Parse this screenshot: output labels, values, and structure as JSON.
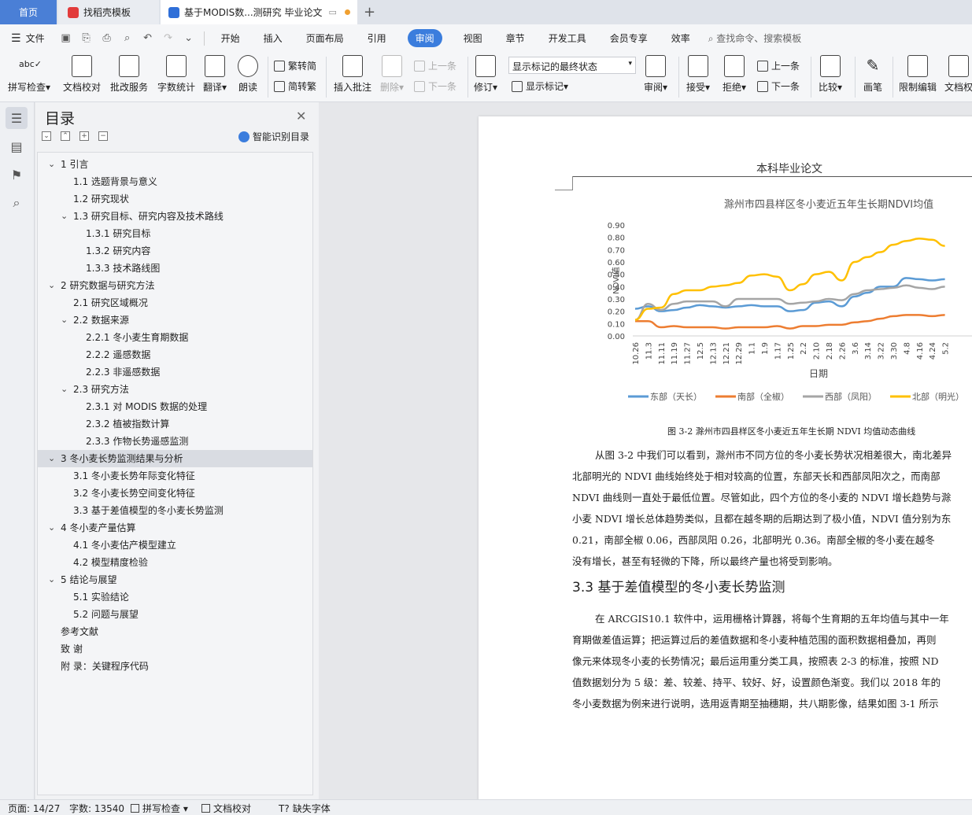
{
  "tabs": {
    "home": "首页",
    "template": "找稻壳模板",
    "doc": "基于MODIS数...测研究 毕业论文"
  },
  "menu": {
    "file": "文件",
    "items": [
      "开始",
      "插入",
      "页面布局",
      "引用",
      "审阅",
      "视图",
      "章节",
      "开发工具",
      "会员专享",
      "效率"
    ],
    "active": "审阅",
    "search": "查找命令、搜索模板"
  },
  "ribbon": {
    "spell": "拼写检查",
    "doc_check": "文档校对",
    "batch": "批改服务",
    "word_count": "字数统计",
    "translate": "翻译",
    "read": "朗读",
    "to_trad": "繁转简",
    "to_simp": "简转繁",
    "insert_comment": "插入批注",
    "delete": "删除",
    "prev": "上一条",
    "next": "下一条",
    "revise": "修订",
    "markup_state": "显示标记的最终状态",
    "show_markup": "显示标记",
    "review": "审阅",
    "accept": "接受",
    "reject": "拒绝",
    "prev2": "上一条",
    "next2": "下一条",
    "compare": "比较",
    "pen": "画笔",
    "restrict": "限制编辑",
    "doc_right": "文档权"
  },
  "toc": {
    "title": "目录",
    "smart": "智能识别目录",
    "items": [
      {
        "label": "1  引言",
        "level": 1,
        "arrow": true
      },
      {
        "label": "1.1  选题背景与意义",
        "level": 2
      },
      {
        "label": "1.2  研究现状",
        "level": 2
      },
      {
        "label": "1.3  研究目标、研究内容及技术路线",
        "level": 2,
        "arrow": true
      },
      {
        "label": "1.3.1  研究目标",
        "level": 3
      },
      {
        "label": "1.3.2  研究内容",
        "level": 3
      },
      {
        "label": "1.3.3  技术路线图",
        "level": 3
      },
      {
        "label": "2  研究数据与研究方法",
        "level": 1,
        "arrow": true
      },
      {
        "label": "2.1  研究区域概况",
        "level": 2
      },
      {
        "label": "2.2  数据来源",
        "level": 2,
        "arrow": true
      },
      {
        "label": "2.2.1  冬小麦生育期数据",
        "level": 3
      },
      {
        "label": "2.2.2  遥感数据",
        "level": 3
      },
      {
        "label": "2.2.3  非遥感数据",
        "level": 3
      },
      {
        "label": "2.3  研究方法",
        "level": 2,
        "arrow": true
      },
      {
        "label": "2.3.1  对 MODIS 数据的处理",
        "level": 3
      },
      {
        "label": "2.3.2  植被指数计算",
        "level": 3
      },
      {
        "label": "2.3.3  作物长势遥感监测",
        "level": 3
      },
      {
        "label": "3  冬小麦长势监测结果与分析",
        "level": 1,
        "arrow": true,
        "selected": true
      },
      {
        "label": "3.1  冬小麦长势年际变化特征",
        "level": 2
      },
      {
        "label": "3.2  冬小麦长势空间变化特征",
        "level": 2
      },
      {
        "label": "3.3  基于差值模型的冬小麦长势监测",
        "level": 2
      },
      {
        "label": "4  冬小麦产量估算",
        "level": 1,
        "arrow": true
      },
      {
        "label": "4.1  冬小麦估产模型建立",
        "level": 2
      },
      {
        "label": "4.2  模型精度检验",
        "level": 2
      },
      {
        "label": "5  结论与展望",
        "level": 1,
        "arrow": true
      },
      {
        "label": "5.1  实验结论",
        "level": 2
      },
      {
        "label": "5.2  问题与展望",
        "level": 2
      },
      {
        "label": "参考文献",
        "level": 0
      },
      {
        "label": "致      谢",
        "level": 0
      },
      {
        "label": "附      录：关键程序代码",
        "level": 0
      }
    ]
  },
  "document": {
    "header": "本科毕业论文",
    "caption": "图 3-2  滁州市四县样区冬小麦近五年生长期 NDVI 均值动态曲线",
    "para1": [
      "从图 3-2 中我们可以看到，滁州市不同方位的冬小麦长势状况相差很大，南北差异",
      "北部明光的 NDVI 曲线始终处于相对较高的位置，东部天长和西部凤阳次之，而南部",
      "NDVI 曲线则一直处于最低位置。尽管如此，四个方位的冬小麦的 NDVI 增长趋势与滁",
      "小麦 NDVI 增长总体趋势类似，且都在越冬期的后期达到了极小值，NDVI 值分别为东",
      "0.21，南部全椒 0.06，西部凤阳 0.26，北部明光 0.36。南部全椒的冬小麦在越冬",
      "没有增长，甚至有轻微的下降，所以最终产量也将受到影响。"
    ],
    "heading": "3.3  基于差值模型的冬小麦长势监测",
    "para2": [
      "在 ARCGIS10.1 软件中，运用栅格计算器，将每个生育期的五年均值与其中一年",
      "育期做差值运算；把运算过后的差值数据和冬小麦种植范围的面积数据相叠加，再则",
      "像元来体现冬小麦的长势情况；最后运用重分类工具，按照表 2-3 的标准，按照 ND",
      "值数据划分为 5 级：差、较差、持平、较好、好，设置颜色渐变。我们以 2018 年的",
      "冬小麦数据为例来进行说明，选用返青期至抽穗期，共八期影像，结果如图 3-1 所示"
    ]
  },
  "chart_data": {
    "type": "line",
    "title": "滁州市四县样区冬小麦近五年生长期NDVI均值",
    "xlabel": "日期",
    "ylabel": "NDVI值",
    "ylim": [
      0,
      0.9
    ],
    "yticks": [
      "0.00",
      "0.10",
      "0.20",
      "0.30",
      "0.40",
      "0.50",
      "0.60",
      "0.70",
      "0.80",
      "0.90"
    ],
    "categories": [
      "10.26",
      "11.3",
      "11.11",
      "11.19",
      "11.27",
      "12.5",
      "12.13",
      "12.21",
      "12.29",
      "1.1",
      "1.9",
      "1.17",
      "1.25",
      "2.2",
      "2.10",
      "2.18",
      "2.26",
      "3.6",
      "3.14",
      "3.22",
      "3.30",
      "4.8",
      "4.16",
      "4.24",
      "5.2"
    ],
    "series": [
      {
        "name": "东部（天长）",
        "color": "#5b9bd5",
        "values": [
          0.22,
          0.24,
          0.2,
          0.21,
          0.23,
          0.25,
          0.24,
          0.23,
          0.24,
          0.25,
          0.24,
          0.24,
          0.2,
          0.21,
          0.27,
          0.28,
          0.24,
          0.32,
          0.35,
          0.4,
          0.4,
          0.47,
          0.46,
          0.45,
          0.46
        ]
      },
      {
        "name": "南部（全椒）",
        "color": "#ed7d31",
        "values": [
          0.12,
          0.12,
          0.07,
          0.08,
          0.07,
          0.07,
          0.07,
          0.06,
          0.07,
          0.07,
          0.07,
          0.08,
          0.06,
          0.08,
          0.08,
          0.09,
          0.09,
          0.11,
          0.12,
          0.14,
          0.16,
          0.17,
          0.17,
          0.16,
          0.17
        ]
      },
      {
        "name": "西部（凤阳）",
        "color": "#a5a5a5",
        "values": [
          0.13,
          0.26,
          0.21,
          0.26,
          0.28,
          0.28,
          0.28,
          0.24,
          0.3,
          0.3,
          0.3,
          0.3,
          0.26,
          0.27,
          0.28,
          0.3,
          0.29,
          0.34,
          0.37,
          0.38,
          0.39,
          0.41,
          0.39,
          0.38,
          0.4
        ]
      },
      {
        "name": "北部（明光）",
        "color": "#ffc000",
        "values": [
          0.13,
          0.22,
          0.23,
          0.34,
          0.37,
          0.37,
          0.4,
          0.41,
          0.43,
          0.49,
          0.5,
          0.48,
          0.37,
          0.42,
          0.5,
          0.52,
          0.45,
          0.6,
          0.64,
          0.68,
          0.74,
          0.77,
          0.79,
          0.78,
          0.73
        ]
      }
    ],
    "legend": "bottom",
    "grid": false
  },
  "status": {
    "page": "页面: 14/27",
    "words": "字数: 13540",
    "spell": "拼写检查",
    "doc_check": "文档校对",
    "missing_font": "缺失字体"
  }
}
